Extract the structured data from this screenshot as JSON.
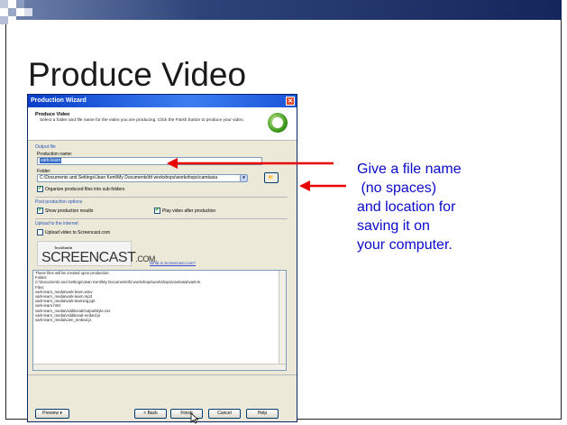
{
  "slide": {
    "title": "Produce Video",
    "annotation_lines": [
      "Give a file name",
      " (no spaces)",
      "and location for",
      "saving it on",
      "your computer."
    ],
    "annotation_color": "#0a0acb",
    "arrow_color": "#e60000"
  },
  "wizard": {
    "window_title": "Production Wizard",
    "close_glyph": "✕",
    "header_title": "Produce Video",
    "header_desc": "Select a folder and file name for the video you are producing.  Click the Finish button to produce your video.",
    "output_group": "Output file",
    "production_name_label": "Production name:",
    "production_name_value": "vark-learn",
    "folder_label": "Folder:",
    "folder_value": "C:\\Documents and Settings\\Jean Kent\\My Documents\\fd workshops\\workshops\\camtasia",
    "organize_label": "Organize produced files into sub-folders",
    "organize_checked": "✔",
    "post_group": "Post production options",
    "show_results_label": "Show production results",
    "show_results_checked": "✔",
    "play_after_label": "Play video after production",
    "play_after_checked": "✔",
    "upload_group": "Upload to the internet",
    "upload_label": "Upload video to Screencast.com",
    "screencast_tech": "TechSmith",
    "screencast_logo": "SCREENCAST",
    "screencast_logo_suffix": ".COM.",
    "screencast_link": "What is Screencast.com?",
    "files_lines": [
      "These files will be created upon production:",
      "Folder:",
      "    C:\\Documents and Settings\\Jean Kent\\My Documents\\fd workshops\\workshops\\camtasia\\vark-le",
      "Files:",
      "    vark-learn_media\\vark-learn.wmv",
      "    vark-learn_media\\vark-learn.mp3",
      "    vark-learn_media\\vark-learning.ppt",
      "    vark-learn.html",
      "    vark-learn_media\\AdditionalOutputStyle.css",
      "    vark-learn_media\\Additional-embed.js",
      "    vark-learn_media\\cam_embed.js"
    ],
    "buttons": {
      "preview": "Preview",
      "back": "< Back",
      "finish": "Finish",
      "cancel": "Cancel",
      "help": "Help"
    }
  }
}
